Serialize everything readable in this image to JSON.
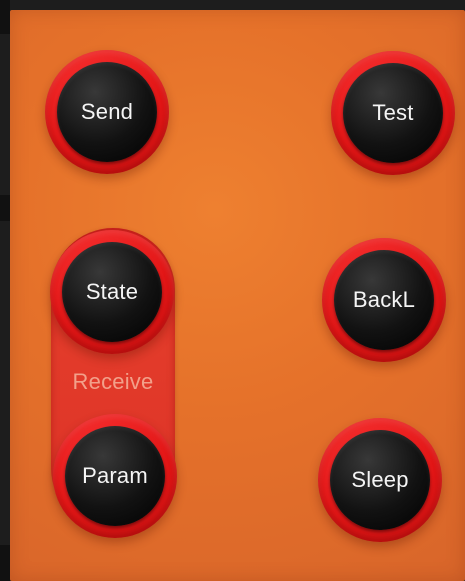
{
  "panel": {
    "receive_label": "Receive",
    "colors": {
      "panel": "#e5712a",
      "key_ring": "#e21616",
      "key_cap": "#111111",
      "receive_strip": "#df2a24"
    }
  },
  "buttons": {
    "send": "Send",
    "test": "Test",
    "state": "State",
    "backl": "BackL",
    "param": "Param",
    "sleep": "Sleep"
  }
}
